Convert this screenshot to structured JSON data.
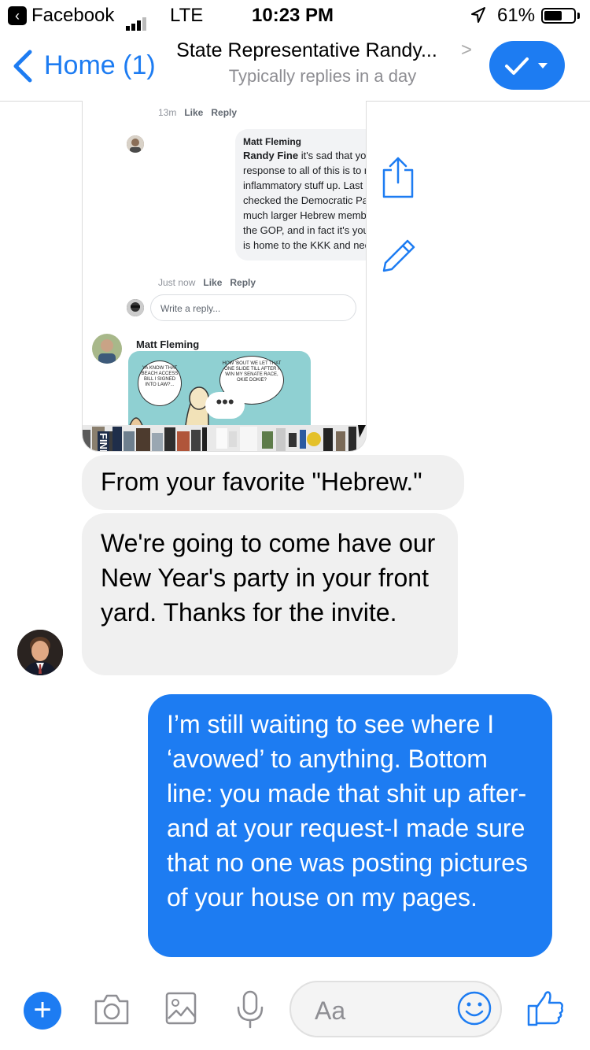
{
  "status_bar": {
    "back_app": "Facebook",
    "network": "LTE",
    "time": "10:23 PM",
    "battery": "61%",
    "battery_level": 0.61
  },
  "nav": {
    "back_label": "Home (1)",
    "title": "State Representative Randy...",
    "subtitle": "Typically replies in a day"
  },
  "shared_post": {
    "top_meta": {
      "time": "13m",
      "like": "Like",
      "reply": "Reply"
    },
    "comment": {
      "author": "Matt Fleming",
      "mention": "Randy Fine",
      "text": "it's sad that your only response to all of this is to make inflammatory stuff up. Last time I checked the Democratic Party has a much larger Hebrew membership than the GOP, and in fact it's your party which is home to the KKK and neo-nazis.",
      "time": "Just now",
      "like": "Like",
      "reply": "Reply"
    },
    "reply_placeholder": "Write a reply...",
    "second_author": "Matt Fleming",
    "cartoon_left": "YA KNOW THAT BEACH ACCESS BILL I SIGNED INTO LAW?...",
    "cartoon_right": "HOW 'BOUT WE LET THAT ONE SLIDE TILL AFTER I WIN MY SENATE RACE, OKIE DOKIE?",
    "strip_label": "FINE"
  },
  "messages": {
    "incoming_1": "From your favorite \"Hebrew.\"",
    "incoming_2": "We're going to come have our New Year's party in your front yard.   Thanks for the invite.",
    "outgoing_1": "I’m still waiting to see where I ‘avowed’ to anything. Bottom line: you made that shit up after-and at your request-I made sure that no one was posting pictures of your house on my pages."
  },
  "composer": {
    "placeholder": "Aa"
  },
  "colors": {
    "accent": "#1d7cf2",
    "incoming_bubble": "#f0f0f0"
  }
}
